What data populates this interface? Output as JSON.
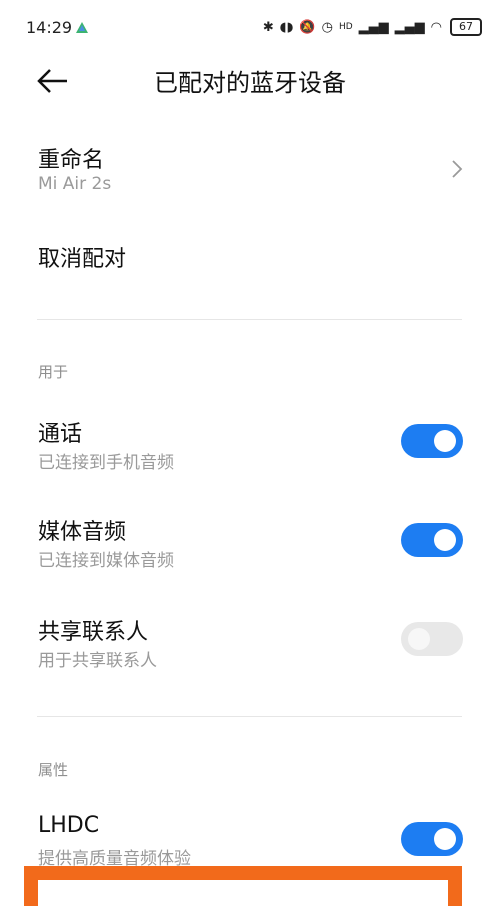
{
  "status_bar": {
    "time": "14:29",
    "signal_label": "HD",
    "battery": "67"
  },
  "header": {
    "title": "已配对的蓝牙设备"
  },
  "rename": {
    "title": "重命名",
    "subtitle": "Mi Air 2s"
  },
  "unpair": {
    "title": "取消配对"
  },
  "section_use": {
    "label": "用于"
  },
  "settings": [
    {
      "title": "通话",
      "subtitle": "已连接到手机音频",
      "enabled": true
    },
    {
      "title": "媒体音频",
      "subtitle": "已连接到媒体音频",
      "enabled": true
    },
    {
      "title": "共享联系人",
      "subtitle": "用于共享联系人",
      "enabled": false
    }
  ],
  "section_props": {
    "label": "属性"
  },
  "lhdc": {
    "title": "LHDC",
    "subtitle": "提供高质量音频体验",
    "enabled": true
  },
  "colors": {
    "accent": "#1d7df2",
    "highlight": "#f26a1b"
  }
}
